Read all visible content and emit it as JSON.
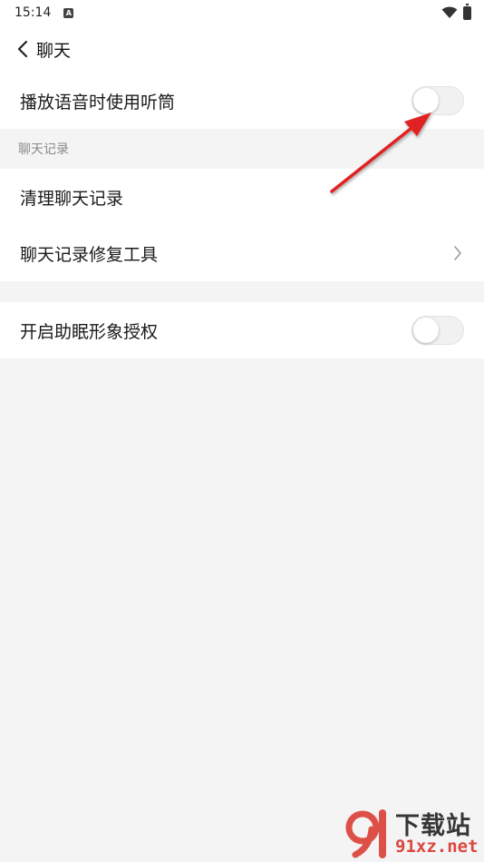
{
  "status_bar": {
    "time": "15:14",
    "notification_icon": "a-icon",
    "wifi_icon": "wifi-icon",
    "battery_icon": "battery-icon"
  },
  "nav": {
    "back_icon": "chevron-left-icon",
    "title": "聊天"
  },
  "settings": {
    "earpiece_label": "播放语音时使用听筒",
    "earpiece_on": false,
    "section_header": "聊天记录",
    "clear_history_label": "清理聊天记录",
    "repair_tool_label": "聊天记录修复工具",
    "sleep_avatar_label": "开启助眠形象授权",
    "sleep_avatar_on": false
  },
  "annotation": {
    "arrow_color": "#e02020"
  },
  "watermark": {
    "logo_text": "91",
    "brand": "下载站",
    "domain": "91xz.net",
    "color": "#d9342b"
  },
  "colors": {
    "background": "#f4f4f4",
    "surface": "#ffffff",
    "text": "#1a1a1a",
    "muted": "#8a8a8a"
  }
}
